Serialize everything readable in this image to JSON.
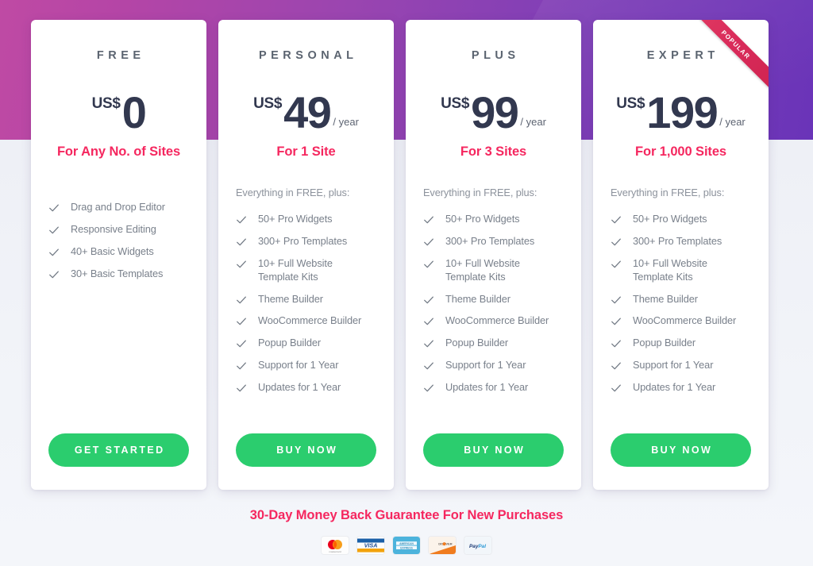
{
  "theme": {
    "gradient_left": "#bf4aa4",
    "gradient_right": "#6a34b8",
    "page_background": "#f0f2f7",
    "accent_pink": "#f5275f",
    "cta_green": "#2bcd6e",
    "price_navy": "#32384f",
    "ribbon_red": "#d92b5a"
  },
  "plans": [
    {
      "id": "free",
      "title": "FREE",
      "currency": "US$",
      "amount": "0",
      "period": "",
      "subtitle": "For Any No. of Sites",
      "plus_note": "",
      "features": [
        "Drag and Drop Editor",
        "Responsive Editing",
        "40+ Basic Widgets",
        "30+ Basic Templates"
      ],
      "cta_label": "GET STARTED",
      "badge": ""
    },
    {
      "id": "personal",
      "title": "PERSONAL",
      "currency": "US$",
      "amount": "49",
      "period": "/ year",
      "subtitle": "For 1 Site",
      "plus_note": "Everything in FREE, plus:",
      "features": [
        "50+ Pro Widgets",
        "300+ Pro Templates",
        "10+ Full Website\nTemplate Kits",
        "Theme Builder",
        "WooCommerce Builder",
        "Popup Builder",
        "Support for 1 Year",
        "Updates for 1 Year"
      ],
      "cta_label": "BUY NOW",
      "badge": ""
    },
    {
      "id": "plus",
      "title": "PLUS",
      "currency": "US$",
      "amount": "99",
      "period": "/ year",
      "subtitle": "For 3 Sites",
      "plus_note": "Everything in FREE, plus:",
      "features": [
        "50+ Pro Widgets",
        "300+ Pro Templates",
        "10+ Full Website\nTemplate Kits",
        "Theme Builder",
        "WooCommerce Builder",
        "Popup Builder",
        "Support for 1 Year",
        "Updates for 1 Year"
      ],
      "cta_label": "BUY NOW",
      "badge": ""
    },
    {
      "id": "expert",
      "title": "EXPERT",
      "currency": "US$",
      "amount": "199",
      "period": "/ year",
      "subtitle": "For 1,000 Sites",
      "plus_note": "Everything in FREE, plus:",
      "features": [
        "50+ Pro Widgets",
        "300+ Pro Templates",
        "10+ Full Website\nTemplate Kits",
        "Theme Builder",
        "WooCommerce Builder",
        "Popup Builder",
        "Support for 1 Year",
        "Updates for 1 Year"
      ],
      "cta_label": "BUY NOW",
      "badge": "POPULAR"
    }
  ],
  "footer": {
    "guarantee": "30-Day Money Back Guarantee For New Purchases",
    "payment_methods": [
      {
        "name": "mastercard-icon",
        "label": "mastercard"
      },
      {
        "name": "visa-icon",
        "label": "VISA"
      },
      {
        "name": "amex-icon",
        "label": "AMERICAN EXPRESS"
      },
      {
        "name": "discover-icon",
        "label": "DISCOVER"
      },
      {
        "name": "paypal-icon",
        "label": "PayPal"
      }
    ]
  },
  "icons": {
    "check": "check-icon"
  }
}
